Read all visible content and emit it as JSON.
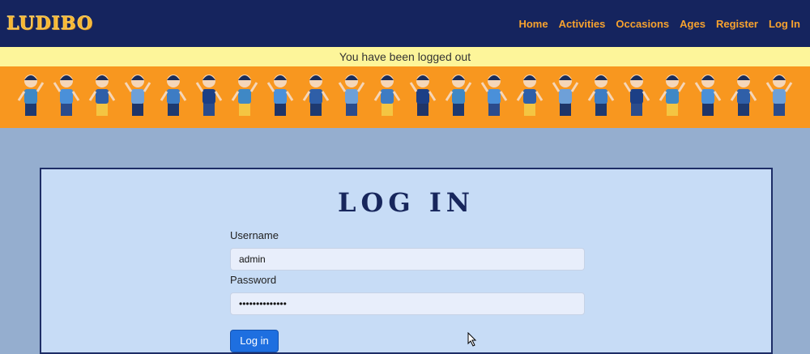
{
  "brand": "LUDIBO",
  "nav": [
    "Home",
    "Activities",
    "Occasions",
    "Ages",
    "Register",
    "Log In"
  ],
  "alert": "You have been logged out",
  "form": {
    "title": "LOG IN",
    "username_label": "Username",
    "username_value": "admin",
    "password_label": "Password",
    "password_value": "••••••••••••••",
    "submit_label": "Log in"
  },
  "colors": {
    "navbar": "#15245e",
    "nav_link": "#f7a22e",
    "alert_bg": "#fdf59a",
    "banner": "#f8971f",
    "page_bg": "#95aecf",
    "card_bg": "#c7dcf6",
    "button": "#1e6fe0"
  },
  "icons": [
    "children-illustration",
    "mouse-pointer-icon"
  ]
}
